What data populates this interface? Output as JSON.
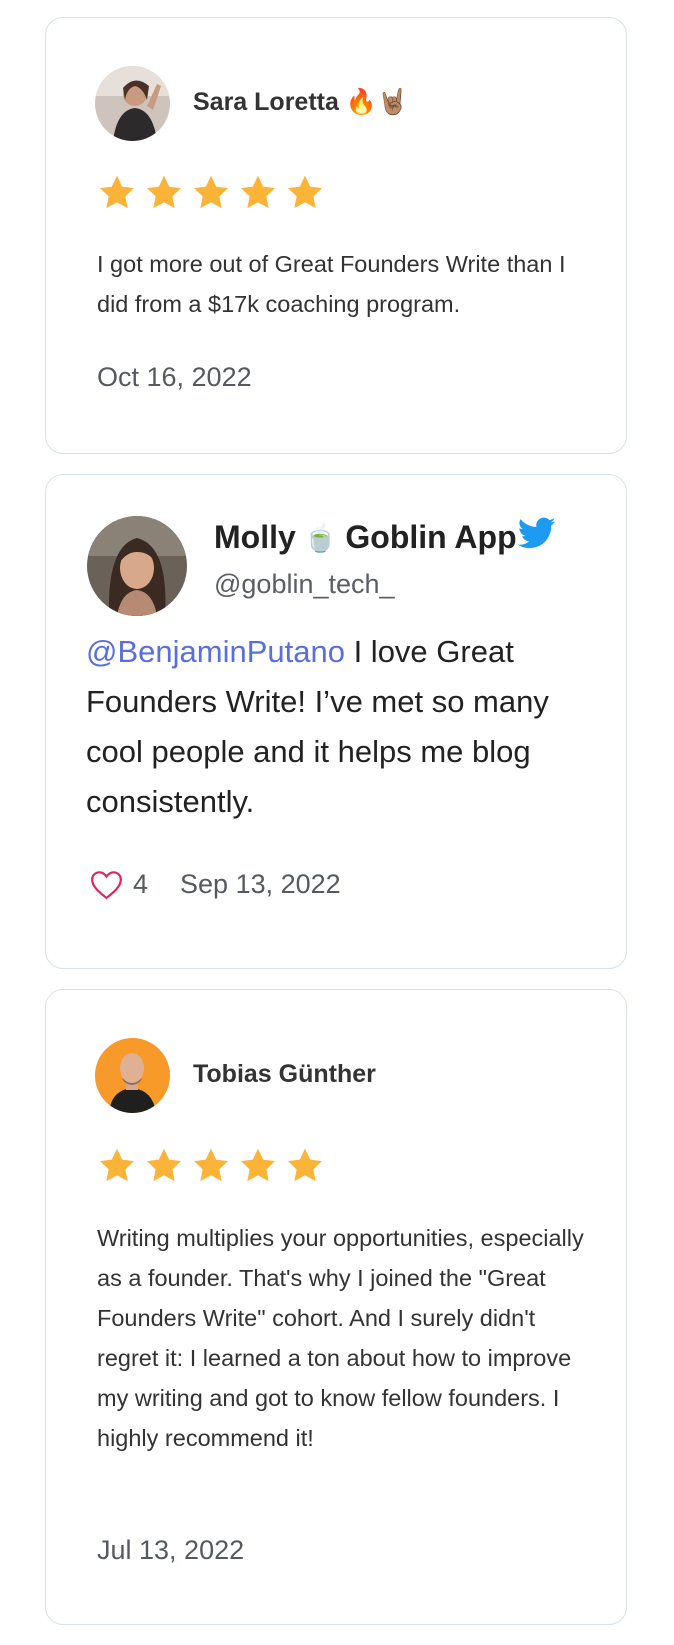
{
  "reviews": [
    {
      "name": "Sara Loretta 🔥🤘🏽",
      "rating": 5,
      "text": "I got more out of Great Founders Write than I did from a $17k coaching program.",
      "date": "Oct 16, 2022"
    },
    {
      "name": "Tobias Günther",
      "rating": 5,
      "text": "Writing multiplies your opportunities, especially as a founder. That's why I joined the \"Great Founders Write\" cohort. And I surely didn't regret it: I learned a ton about how to improve my writing and got to know fellow founders. I highly recommend it!",
      "date": "Jul 13, 2022"
    }
  ],
  "tweet": {
    "name_first": "Molly",
    "name_emoji": "🍵",
    "name_rest": "Goblin App",
    "handle": "@goblin_tech_",
    "mention": "@BenjaminPutano",
    "text": " I love Great Founders Write! I’ve met so many cool people and it helps me blog consistently.",
    "likes": "4",
    "date": "Sep 13, 2022"
  },
  "colors": {
    "star": "#fbb338",
    "mention": "#5b6fdc",
    "twitter": "#1d9bf0",
    "heart": "#e0245e",
    "card_border": "#d7e2ea"
  }
}
